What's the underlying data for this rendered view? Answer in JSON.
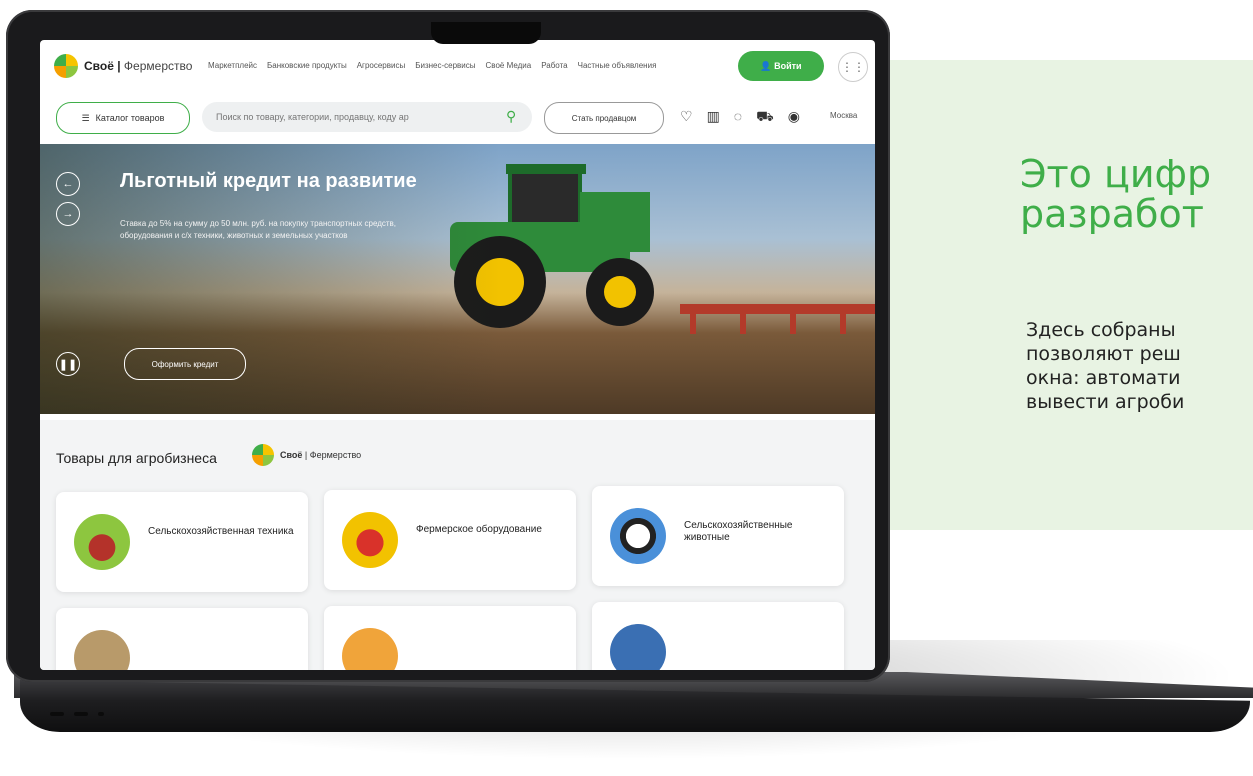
{
  "promo": {
    "title_line1": "Это цифр",
    "title_line2": "разработ",
    "text_lines": [
      "Здесь собраны",
      "позволяют  реш",
      "окна: автомати",
      "вывести агроби"
    ]
  },
  "site": {
    "logo_brand": "Своё",
    "logo_section": "Фермерство",
    "nav": [
      "Маркетплейс",
      "Банковские продукты",
      "Агросервисы",
      "Бизнес-сервисы",
      "Своё Медиа",
      "Работа",
      "Частные объявления"
    ],
    "login_label": "Войти",
    "catalog_label": "Каталог товаров",
    "search_placeholder": "Поиск по товару, категории, продавцу, коду ар",
    "seller_label": "Стать продавцом",
    "city": "Москва",
    "hero": {
      "title": "Льготный кредит на развитие",
      "subtitle": "Ставка до 5% на сумму до 50 млн. руб. на покупку транспортных средств, оборудования и с/х техники, животных и земельных участков",
      "button": "Оформить кредит"
    },
    "section_title": "Товары для агробизнеса",
    "section_logo_brand": "Своё",
    "section_logo_text": "Фермерство",
    "categories": [
      {
        "label": "Сельскохозяйственная техника"
      },
      {
        "label": "Фермерское оборудование"
      },
      {
        "label": "Сельскохозяйственные животные"
      }
    ]
  },
  "colors": {
    "accent": "#3fae49",
    "promo_dark": "#3f9d44",
    "promo_light": "#e8f3e3"
  }
}
